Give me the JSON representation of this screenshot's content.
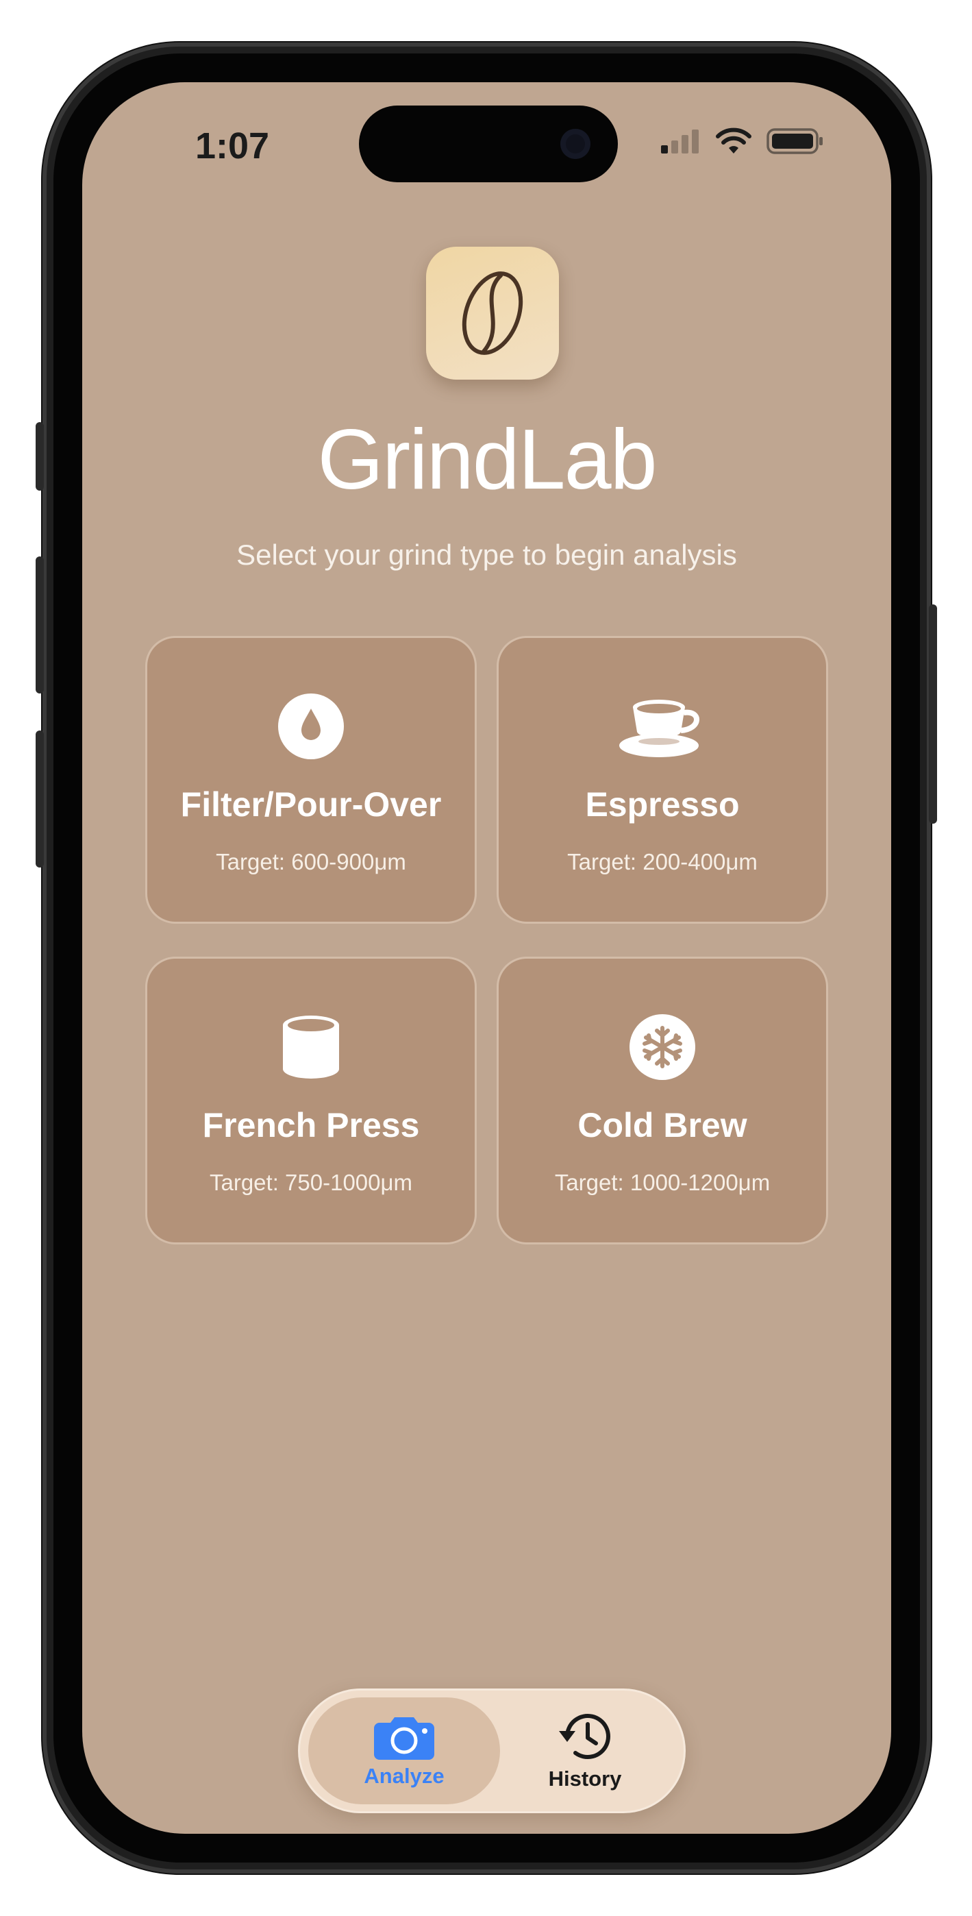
{
  "status_bar": {
    "time": "1:07"
  },
  "app": {
    "title": "GrindLab",
    "subtitle": "Select your grind type to begin analysis",
    "icon": "coffee-bean-icon"
  },
  "grind_types": [
    {
      "icon": "water-drop-icon",
      "title": "Filter/Pour-Over",
      "target": "Target: 600-900μm"
    },
    {
      "icon": "coffee-cup-icon",
      "title": "Espresso",
      "target": "Target: 200-400μm"
    },
    {
      "icon": "cylinder-icon",
      "title": "French Press",
      "target": "Target: 750-1000μm"
    },
    {
      "icon": "snowflake-icon",
      "title": "Cold Brew",
      "target": "Target: 1000-1200μm"
    }
  ],
  "tabs": [
    {
      "label": "Analyze",
      "icon": "camera-icon",
      "selected": true
    },
    {
      "label": "History",
      "icon": "history-clock-icon",
      "selected": false
    }
  ],
  "colors": {
    "background": "#bfa691",
    "card": "#b39279",
    "tab_active_text": "#3b82f6",
    "tab_inactive_text": "#1a1a1a"
  }
}
